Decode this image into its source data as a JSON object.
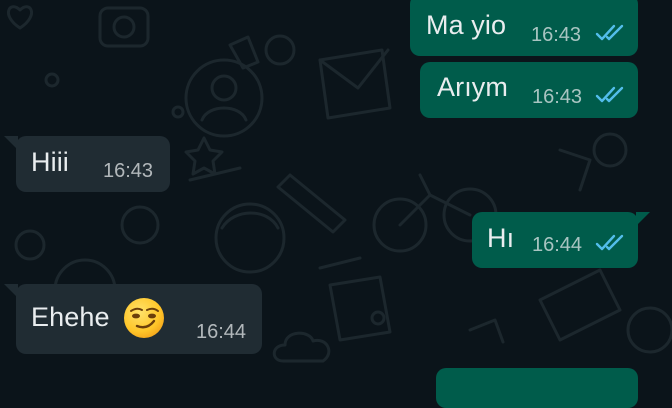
{
  "chat": {
    "messages": [
      {
        "direction": "outgoing",
        "text": "Ma yio",
        "time": "16:43",
        "status": "read"
      },
      {
        "direction": "outgoing",
        "text": "Arıym",
        "time": "16:43",
        "status": "read"
      },
      {
        "direction": "incoming",
        "text": "Hiii",
        "time": "16:43"
      },
      {
        "direction": "outgoing",
        "text": "Hı",
        "time": "16:44",
        "status": "read"
      },
      {
        "direction": "incoming",
        "text": "Ehehe",
        "time": "16:44",
        "emoji": "smirking-face"
      }
    ]
  },
  "colors": {
    "background": "#0b141a",
    "outgoing_bubble": "#005c4b",
    "incoming_bubble": "#202c33",
    "text": "#e9edef",
    "read_ticks": "#53bdeb"
  }
}
